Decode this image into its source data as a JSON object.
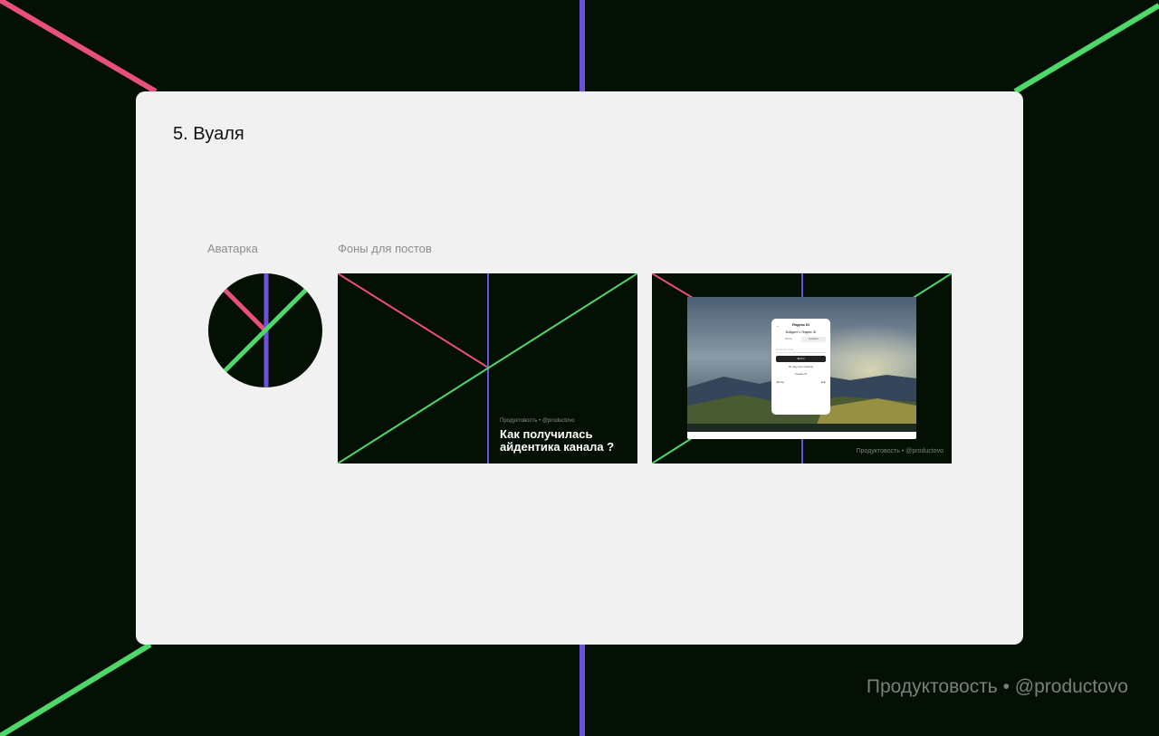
{
  "slide": {
    "title": "5. Вуаля",
    "avatar_label": "Аватарка",
    "posts_label": "Фоны для постов"
  },
  "post1": {
    "caption": "Продуктовость • @productovo",
    "heading": "Как получилась айдентика канала ?"
  },
  "post2": {
    "caption": "Продуктовость • @productovo",
    "login_logo": "Яндекс ID",
    "login_title": "Войдите с Яндекс ID",
    "tab_left": "Почта",
    "tab_right": "Телефон",
    "field_placeholder": "Логин или email",
    "submit_label": "Войти",
    "alt_label": "По лицу или отпечатку",
    "create_label": "Создать ID",
    "qr_label": "QR-код",
    "more_label": "Ещё"
  },
  "footer": {
    "brand": "Продуктовость • @productovo"
  },
  "colors": {
    "background": "#041004",
    "pink": "#e8507a",
    "violet": "#6b52d8",
    "green": "#4fd86a",
    "card": "#f1f1f1"
  }
}
